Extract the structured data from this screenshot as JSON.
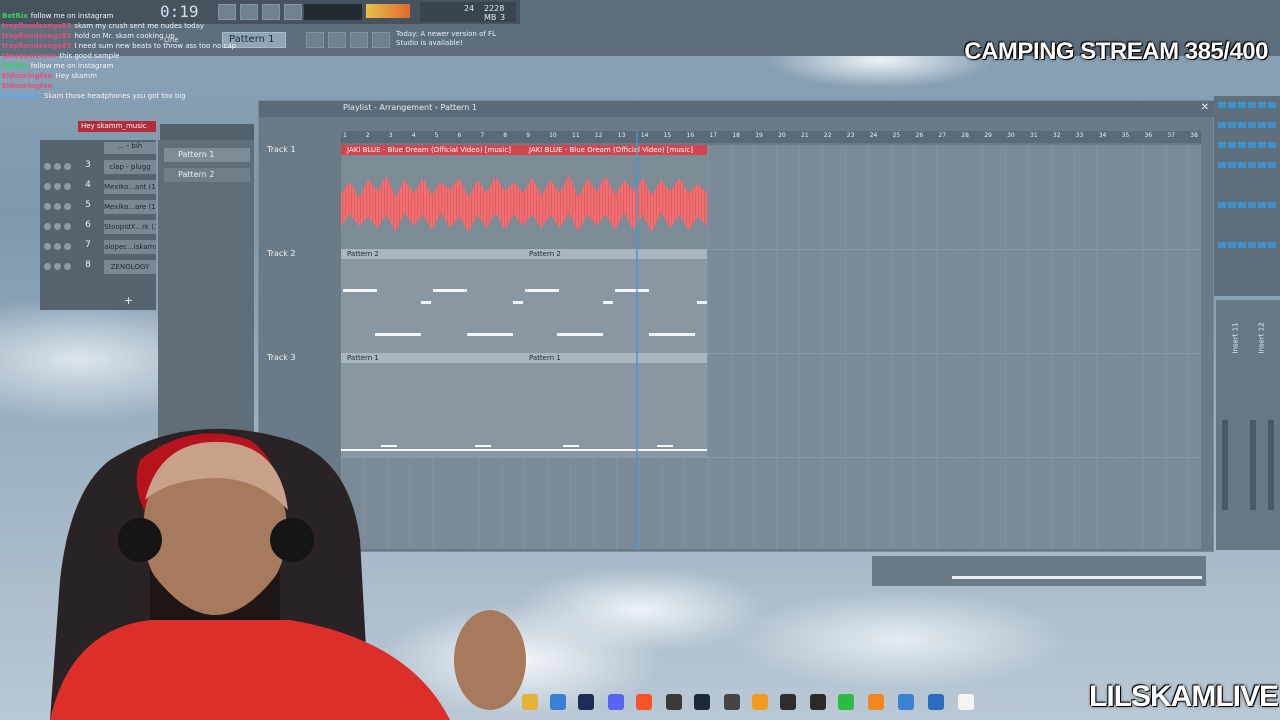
{
  "overlay": {
    "stream_title": "CAMPING STREAM 385/400",
    "watermark": "LILSKAMLIVE"
  },
  "toolbar": {
    "time": "0:19",
    "pattern_select": "Pattern 1",
    "line_mode": "Line",
    "update_notice": "Today: A newer version of FL Studio is available!",
    "cpu_value": "24",
    "memory": "2228 MB",
    "voices": "3"
  },
  "chat": [
    {
      "user": "BotRix",
      "message": "follow me on instagram",
      "color": "#35d16a"
    },
    {
      "user": "trapfiendsongs83",
      "message": "skam my crush sent me nudes today",
      "color": "#e0527a"
    },
    {
      "user": "trapfiendsongs83",
      "message": "hold on Mr. skam cooking up",
      "color": "#e0527a"
    },
    {
      "user": "trapfiendsongs83",
      "message": "I need sum new beats to throw ass too no cap",
      "color": "#e0527a"
    },
    {
      "user": "theresorceror",
      "message": "this good sample",
      "color": "#e0527a"
    },
    {
      "user": "BotRix",
      "message": "follow me on instagram",
      "color": "#35d16a"
    },
    {
      "user": "Eldenringfan",
      "message": "Hey skamm",
      "color": "#e0527a"
    },
    {
      "user": "Eldenringfan",
      "message": "",
      "color": "#e0527a"
    },
    {
      "user": "KennyAce",
      "message": "Skam those headphones you got too big",
      "color": "#5aa8ff"
    }
  ],
  "chat_alert": "Hey skamm_music",
  "channel_rack": {
    "channels": [
      {
        "num": "3",
        "name": "clap - plugg"
      },
      {
        "num": "4",
        "name": "Mexiko...ant (1)"
      },
      {
        "num": "5",
        "name": "Mexiko...are (1)"
      },
      {
        "num": "6",
        "name": "StoopidX...rk (1)"
      },
      {
        "num": "7",
        "name": "alopec...lskamx"
      },
      {
        "num": "8",
        "name": "ZENOLOGY"
      }
    ],
    "partial_top": "... - bih",
    "add_label": "+"
  },
  "picker": {
    "items": [
      "Pattern 1",
      "Pattern 2"
    ]
  },
  "playlist": {
    "title": "Playlist - Arrangement › Pattern 1",
    "ruler_ticks": [
      "1",
      "2",
      "3",
      "4",
      "5",
      "6",
      "7",
      "8",
      "9",
      "10",
      "11",
      "12",
      "13",
      "14",
      "15",
      "16",
      "17",
      "18",
      "19",
      "20",
      "21",
      "22",
      "23",
      "24",
      "25",
      "26",
      "27",
      "28",
      "29",
      "30",
      "31",
      "32",
      "33",
      "34",
      "35",
      "36",
      "37",
      "38"
    ],
    "tracks": [
      {
        "label": "Track 1"
      },
      {
        "label": "Track 2"
      },
      {
        "label": "Track 3"
      }
    ],
    "audio_clips": [
      "JAKI BLUE - Blue Dream (Official Video) [music]",
      "JAKI BLUE - Blue Dream (Official Video) [music]"
    ],
    "track2_clips": [
      "Pattern 2",
      "Pattern 2"
    ],
    "track3_clips": [
      "Pattern 1",
      "Pattern 1"
    ]
  },
  "mixer": {
    "inserts": [
      "Insert 11",
      "Insert 12"
    ]
  }
}
